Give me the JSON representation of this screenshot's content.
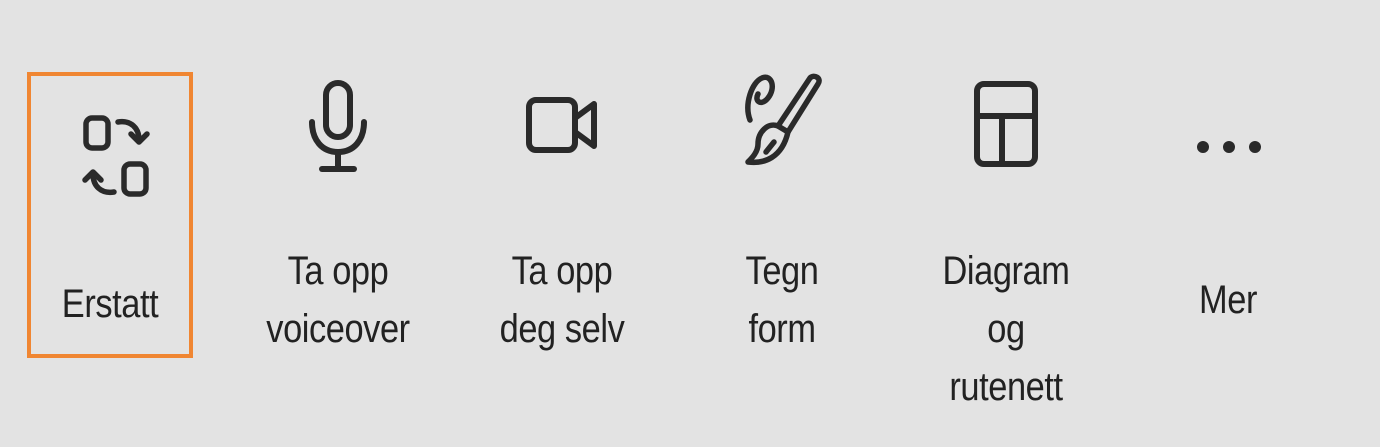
{
  "toolbar": {
    "accent_color": "#f08632",
    "background_color": "#e3e3e3",
    "items": [
      {
        "icon": "replace-icon",
        "label_lines": [
          "Erstatt"
        ],
        "selected": true
      },
      {
        "icon": "microphone-icon",
        "label_lines": [
          "Ta opp",
          "voiceover"
        ],
        "selected": false
      },
      {
        "icon": "video-camera-icon",
        "label_lines": [
          "Ta opp",
          "deg selv"
        ],
        "selected": false
      },
      {
        "icon": "brush-icon",
        "label_lines": [
          "Tegn",
          "form"
        ],
        "selected": false
      },
      {
        "icon": "layout-grid-icon",
        "label_lines": [
          "Diagram",
          "og",
          "rutenett"
        ],
        "selected": false
      },
      {
        "icon": "more-icon",
        "label_lines": [
          "Mer"
        ],
        "selected": false
      }
    ]
  }
}
